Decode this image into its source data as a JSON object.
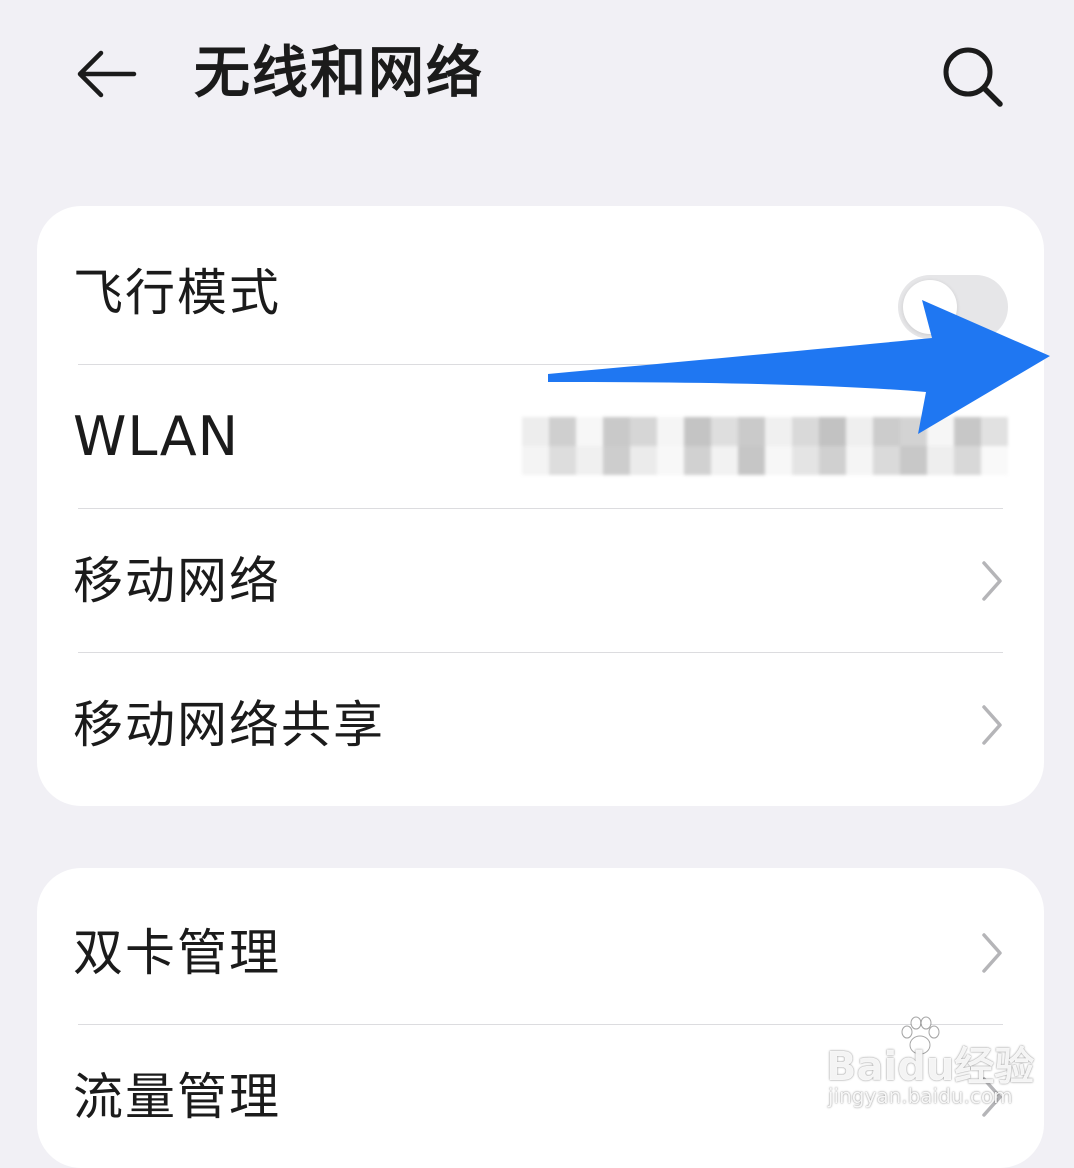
{
  "header": {
    "title": "无线和网络",
    "back_icon": "arrow-left-icon",
    "search_icon": "search-icon"
  },
  "sections": [
    {
      "items": [
        {
          "label": "飞行模式",
          "control": "toggle",
          "toggle_on": false
        },
        {
          "label": "WLAN",
          "value_obscured": true
        },
        {
          "label": "移动网络",
          "control": "chevron"
        },
        {
          "label": "移动网络共享",
          "control": "chevron"
        }
      ]
    },
    {
      "items": [
        {
          "label": "双卡管理",
          "control": "chevron"
        },
        {
          "label": "流量管理",
          "control": "chevron"
        }
      ]
    }
  ],
  "annotation": {
    "icon": "blue-arrow-right-icon",
    "color": "#1f77f2"
  },
  "watermark": {
    "brand": "Baidu经验",
    "url": "jingyan.baidu.com"
  },
  "colors": {
    "background": "#f1f0f5",
    "card": "#ffffff",
    "text": "#1b1b1b",
    "divider": "#dcdcdf",
    "toggle_off": "#e6e6e8",
    "chevron": "#b5b5b8"
  }
}
